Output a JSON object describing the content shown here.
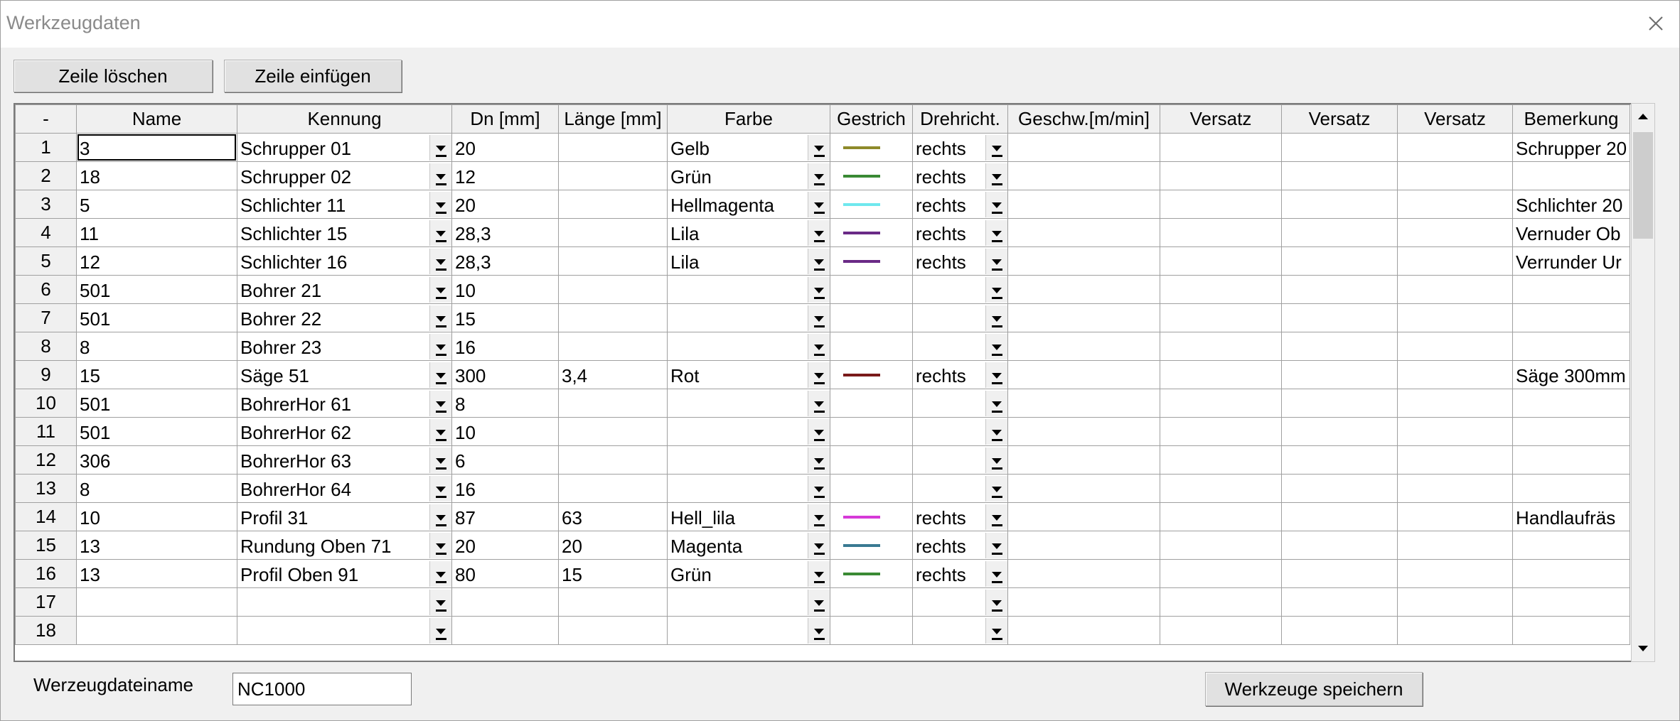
{
  "window": {
    "title": "Werkzeugdaten"
  },
  "toolbar": {
    "delete_row": "Zeile löschen",
    "insert_row": "Zeile einfügen"
  },
  "columns": [
    "-",
    "Name",
    "Kennung",
    "Dn [mm]",
    "Länge [mm]",
    "Farbe",
    "Gestrich",
    "Drehricht.",
    "Geschw.[m/min]",
    "Versatz",
    "Versatz",
    "Versatz",
    "Bemerkung"
  ],
  "rows": [
    {
      "num": "1",
      "name": "3",
      "kennung": "Schrupper 01",
      "dn": "20",
      "laenge": "",
      "farbe": "Gelb",
      "line_color": "#8e8a2a",
      "dreh": "rechts",
      "geschw": "",
      "v1": "",
      "v2": "",
      "v3": "",
      "bemerkung": "Schrupper 20"
    },
    {
      "num": "2",
      "name": "18",
      "kennung": "Schrupper 02",
      "dn": "12",
      "laenge": "",
      "farbe": "Grün",
      "line_color": "#3a8a34",
      "dreh": "rechts",
      "geschw": "",
      "v1": "",
      "v2": "",
      "v3": "",
      "bemerkung": ""
    },
    {
      "num": "3",
      "name": "5",
      "kennung": "Schlichter 11",
      "dn": "20",
      "laenge": "",
      "farbe": "Hellmagenta",
      "line_color": "#6fe8ee",
      "dreh": "rechts",
      "geschw": "",
      "v1": "",
      "v2": "",
      "v3": "",
      "bemerkung": "Schlichter 20"
    },
    {
      "num": "4",
      "name": "11",
      "kennung": "Schlichter 15",
      "dn": "28,3",
      "laenge": "",
      "farbe": "Lila",
      "line_color": "#6a2a86",
      "dreh": "rechts",
      "geschw": "",
      "v1": "",
      "v2": "",
      "v3": "",
      "bemerkung": "Vernuder Ob"
    },
    {
      "num": "5",
      "name": "12",
      "kennung": "Schlichter 16",
      "dn": "28,3",
      "laenge": "",
      "farbe": "Lila",
      "line_color": "#6a2a86",
      "dreh": "rechts",
      "geschw": "",
      "v1": "",
      "v2": "",
      "v3": "",
      "bemerkung": "Verrunder Ur"
    },
    {
      "num": "6",
      "name": "501",
      "kennung": "Bohrer 21",
      "dn": "10",
      "laenge": "",
      "farbe": "",
      "line_color": "",
      "dreh": "",
      "geschw": "",
      "v1": "",
      "v2": "",
      "v3": "",
      "bemerkung": ""
    },
    {
      "num": "7",
      "name": "501",
      "kennung": "Bohrer 22",
      "dn": "15",
      "laenge": "",
      "farbe": "",
      "line_color": "",
      "dreh": "",
      "geschw": "",
      "v1": "",
      "v2": "",
      "v3": "",
      "bemerkung": ""
    },
    {
      "num": "8",
      "name": "8",
      "kennung": "Bohrer 23",
      "dn": "16",
      "laenge": "",
      "farbe": "",
      "line_color": "",
      "dreh": "",
      "geschw": "",
      "v1": "",
      "v2": "",
      "v3": "",
      "bemerkung": ""
    },
    {
      "num": "9",
      "name": "15",
      "kennung": "Säge 51",
      "dn": "300",
      "laenge": "3,4",
      "farbe": "Rot",
      "line_color": "#7a1a1a",
      "dreh": "rechts",
      "geschw": "",
      "v1": "",
      "v2": "",
      "v3": "",
      "bemerkung": "Säge 300mm"
    },
    {
      "num": "10",
      "name": "501",
      "kennung": "BohrerHor 61",
      "dn": "8",
      "laenge": "",
      "farbe": "",
      "line_color": "",
      "dreh": "",
      "geschw": "",
      "v1": "",
      "v2": "",
      "v3": "",
      "bemerkung": ""
    },
    {
      "num": "11",
      "name": "501",
      "kennung": "BohrerHor 62",
      "dn": "10",
      "laenge": "",
      "farbe": "",
      "line_color": "",
      "dreh": "",
      "geschw": "",
      "v1": "",
      "v2": "",
      "v3": "",
      "bemerkung": ""
    },
    {
      "num": "12",
      "name": "306",
      "kennung": "BohrerHor 63",
      "dn": "6",
      "laenge": "",
      "farbe": "",
      "line_color": "",
      "dreh": "",
      "geschw": "",
      "v1": "",
      "v2": "",
      "v3": "",
      "bemerkung": ""
    },
    {
      "num": "13",
      "name": "8",
      "kennung": "BohrerHor 64",
      "dn": "16",
      "laenge": "",
      "farbe": "",
      "line_color": "",
      "dreh": "",
      "geschw": "",
      "v1": "",
      "v2": "",
      "v3": "",
      "bemerkung": ""
    },
    {
      "num": "14",
      "name": "10",
      "kennung": "Profil 31",
      "dn": "87",
      "laenge": "63",
      "farbe": "Hell_lila",
      "line_color": "#d63ad8",
      "dreh": "rechts",
      "geschw": "",
      "v1": "",
      "v2": "",
      "v3": "",
      "bemerkung": "Handlaufräs"
    },
    {
      "num": "15",
      "name": "13",
      "kennung": "Rundung Oben 71",
      "dn": "20",
      "laenge": "20",
      "farbe": "Magenta",
      "line_color": "#3a7a92",
      "dreh": "rechts",
      "geschw": "",
      "v1": "",
      "v2": "",
      "v3": "",
      "bemerkung": ""
    },
    {
      "num": "16",
      "name": "13",
      "kennung": "Profil Oben 91",
      "dn": "80",
      "laenge": "15",
      "farbe": "Grün",
      "line_color": "#3a8a34",
      "dreh": "rechts",
      "geschw": "",
      "v1": "",
      "v2": "",
      "v3": "",
      "bemerkung": ""
    },
    {
      "num": "17",
      "name": "",
      "kennung": "",
      "dn": "",
      "laenge": "",
      "farbe": "",
      "line_color": "",
      "dreh": "",
      "geschw": "",
      "v1": "",
      "v2": "",
      "v3": "",
      "bemerkung": ""
    },
    {
      "num": "18",
      "name": "",
      "kennung": "",
      "dn": "",
      "laenge": "",
      "farbe": "",
      "line_color": "",
      "dreh": "",
      "geschw": "",
      "v1": "",
      "v2": "",
      "v3": "",
      "bemerkung": ""
    }
  ],
  "footer": {
    "filename_label": "Werzeugdateiname",
    "filename_value": "NC1000",
    "save_button": "Werkzeuge speichern"
  }
}
